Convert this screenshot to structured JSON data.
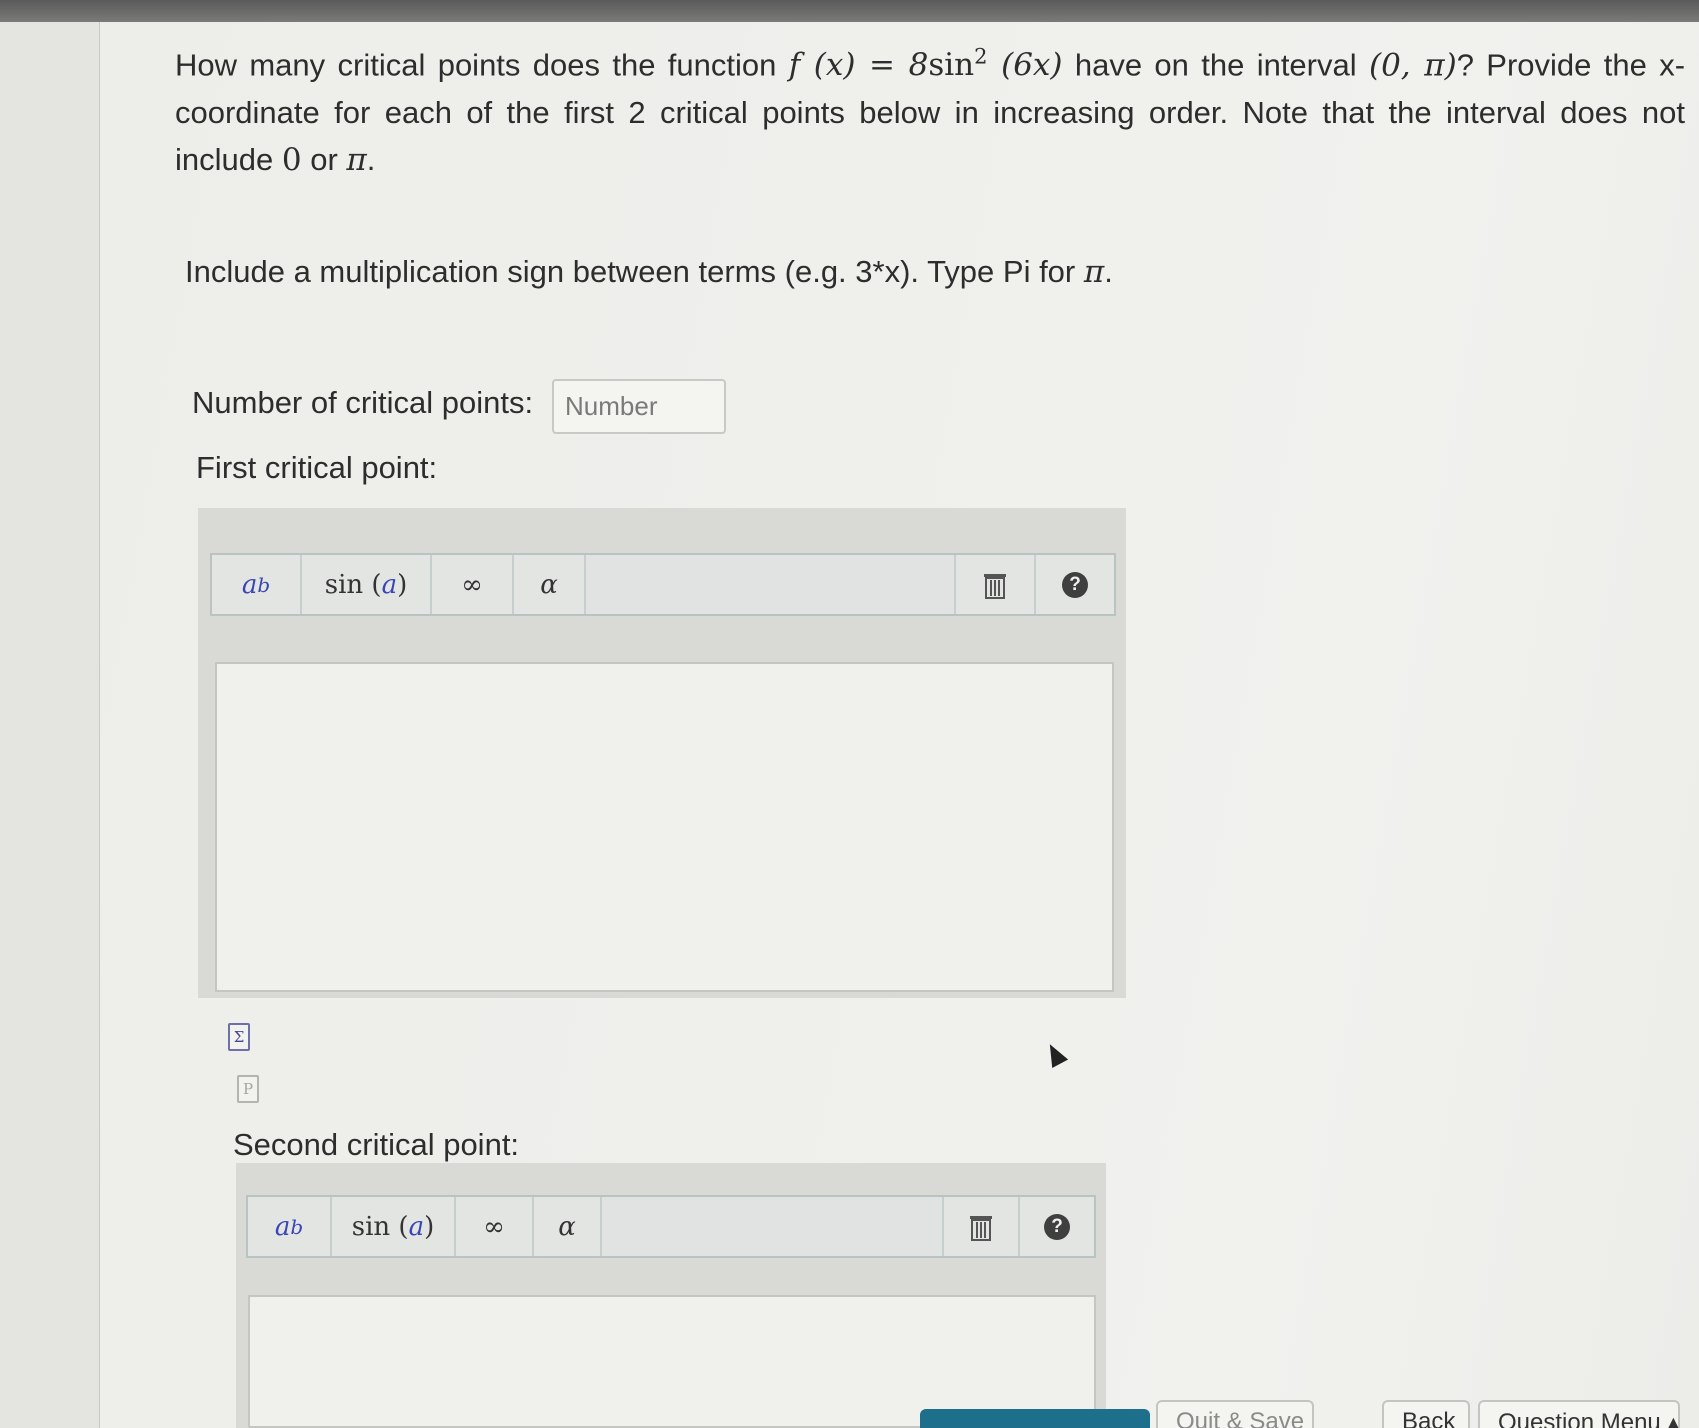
{
  "question": {
    "text_before": "How many critical points does the function ",
    "function": {
      "lhs": "f (x) = 8",
      "fn": "sin",
      "exponent": "2",
      "argument": " (6x)"
    },
    "text_middle": " have on the interval ",
    "interval": "(0, π)",
    "text_after": "? Provide the x-coordinate for each of the first 2 critical points below in increasing order. Note that the interval does not include ",
    "exclusion_zero": "0",
    "exclusion_or": " or ",
    "exclusion_pi": "π",
    "end": "."
  },
  "instruction": {
    "text": "Include a multiplication sign between terms (e.g. 3*x). Type Pi for ",
    "pi": "π",
    "end": "."
  },
  "count_field": {
    "label": "Number of critical points:",
    "placeholder": "Number",
    "value": ""
  },
  "first_point": {
    "label": "First critical point:",
    "toolbar": {
      "power_base": "a",
      "power_exp": "b",
      "sin_fn": "sin",
      "sin_arg": "a",
      "infinity": "∞",
      "alpha": "α",
      "trash": "🗑",
      "help": "?"
    },
    "answer": ""
  },
  "second_point": {
    "label": "Second critical point:",
    "toolbar": {
      "power_base": "a",
      "power_exp": "b",
      "sin_fn": "sin",
      "sin_arg": "a",
      "infinity": "∞",
      "alpha": "α",
      "trash": "🗑",
      "help": "?"
    },
    "answer": ""
  },
  "icons": {
    "equation_icon": "Σ",
    "preview_icon": "P"
  },
  "footer": {
    "quit_save": "Quit & Save",
    "back": "Back",
    "question_menu": "Question Menu ▴"
  },
  "colors": {
    "primary_button": "#1d6f8c",
    "math_variable": "#3a46b5"
  }
}
